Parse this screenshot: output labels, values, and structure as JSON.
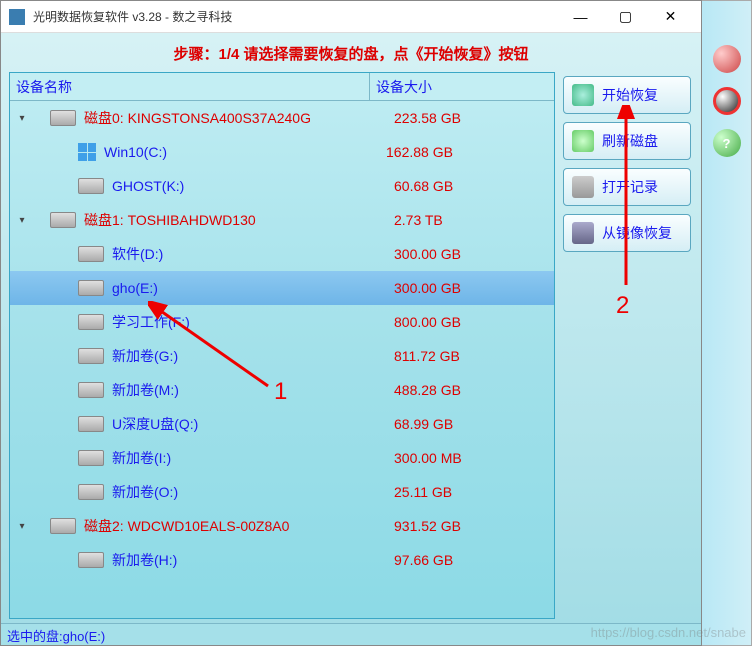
{
  "title": "光明数据恢复软件 v3.28 - 数之寻科技",
  "step_instruction": "步骤：1/4 请选择需要恢复的盘，点《开始恢复》按钮",
  "columns": {
    "name": "设备名称",
    "size": "设备大小"
  },
  "disks": [
    {
      "label": "磁盘0: KINGSTONSA400S37A240G",
      "size": "223.58 GB",
      "partitions": [
        {
          "label": "Win10(C:)",
          "size": "162.88 GB",
          "icon": "windows"
        },
        {
          "label": "GHOST(K:)",
          "size": "60.68 GB"
        }
      ]
    },
    {
      "label": "磁盘1: TOSHIBAHDWD130",
      "size": "2.73 TB",
      "partitions": [
        {
          "label": "软件(D:)",
          "size": "300.00 GB"
        },
        {
          "label": "gho(E:)",
          "size": "300.00 GB",
          "selected": true
        },
        {
          "label": "学习工作(F:)",
          "size": "800.00 GB"
        },
        {
          "label": "新加卷(G:)",
          "size": "811.72 GB"
        },
        {
          "label": "新加卷(M:)",
          "size": "488.28 GB"
        },
        {
          "label": "U深度U盘(Q:)",
          "size": "68.99 GB"
        },
        {
          "label": "新加卷(I:)",
          "size": "300.00 MB"
        },
        {
          "label": "新加卷(O:)",
          "size": "25.11 GB"
        }
      ]
    },
    {
      "label": "磁盘2: WDCWD10EALS-00Z8A0",
      "size": "931.52 GB",
      "partitions": [
        {
          "label": "新加卷(H:)",
          "size": "97.66 GB"
        }
      ]
    }
  ],
  "actions": {
    "start": "开始恢复",
    "refresh": "刷新磁盘",
    "open": "打开记录",
    "mirror": "从镜像恢复"
  },
  "status": "选中的盘:gho(E:)",
  "annotations": {
    "a1": "1",
    "a2": "2"
  },
  "help_glyph": "?",
  "watermark": "https://blog.csdn.net/snabe"
}
